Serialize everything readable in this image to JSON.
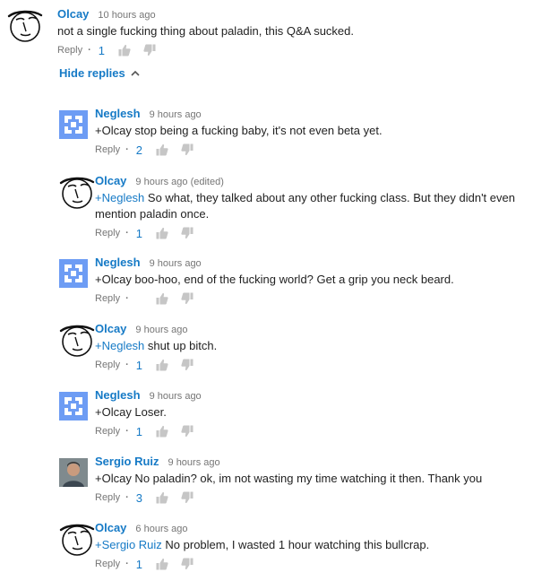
{
  "top_comment": {
    "author": "Olcay",
    "time": "10 hours ago",
    "text": "not a single fucking thing about paladin, this Q&A sucked.",
    "reply_label": "Reply",
    "likes": "1"
  },
  "hide_replies_label": "Hide replies",
  "replies": [
    {
      "author": "Neglesh",
      "time": "9 hours ago",
      "mention": "",
      "text": "+Olcay stop being a fucking baby, it's not even beta yet.",
      "reply_label": "Reply",
      "likes": "2",
      "avatar": "grid-avatar"
    },
    {
      "author": "Olcay",
      "time": "9 hours ago (edited)",
      "mention": "+Neglesh",
      "text": " So what, they talked about any other fucking class. But they didn't even mention paladin once.",
      "reply_label": "Reply",
      "likes": "1",
      "avatar": "sketch-avatar"
    },
    {
      "author": "Neglesh",
      "time": "9 hours ago",
      "mention": "",
      "text": "+Olcay boo-hoo, end of the fucking world? Get a grip you neck beard.",
      "reply_label": "Reply",
      "likes": "",
      "avatar": "grid-avatar"
    },
    {
      "author": "Olcay",
      "time": "9 hours ago",
      "mention": "+Neglesh",
      "text": " shut up bitch.",
      "reply_label": "Reply",
      "likes": "1",
      "avatar": "sketch-avatar"
    },
    {
      "author": "Neglesh",
      "time": "9 hours ago",
      "mention": "",
      "text": "+Olcay Loser.",
      "reply_label": "Reply",
      "likes": "1",
      "avatar": "grid-avatar"
    },
    {
      "author": "Sergio Ruiz",
      "time": "9 hours ago",
      "mention": "",
      "text": "+Olcay No paladin? ok, im not wasting my time watching it then. Thank you",
      "reply_label": "Reply",
      "likes": "3",
      "avatar": "photo-avatar"
    },
    {
      "author": "Olcay",
      "time": "6 hours ago",
      "mention": "+Sergio Ruiz",
      "text": " No problem, I wasted 1 hour watching this bullcrap.",
      "reply_label": "Reply",
      "likes": "1",
      "avatar": "sketch-avatar"
    }
  ],
  "colors": {
    "link_blue": "#167ac6",
    "meta_gray": "#767676",
    "grid_avatar": "#6d9cf4"
  },
  "icons": [
    "thumbs-up-icon",
    "thumbs-down-icon",
    "chevron-up-icon"
  ]
}
